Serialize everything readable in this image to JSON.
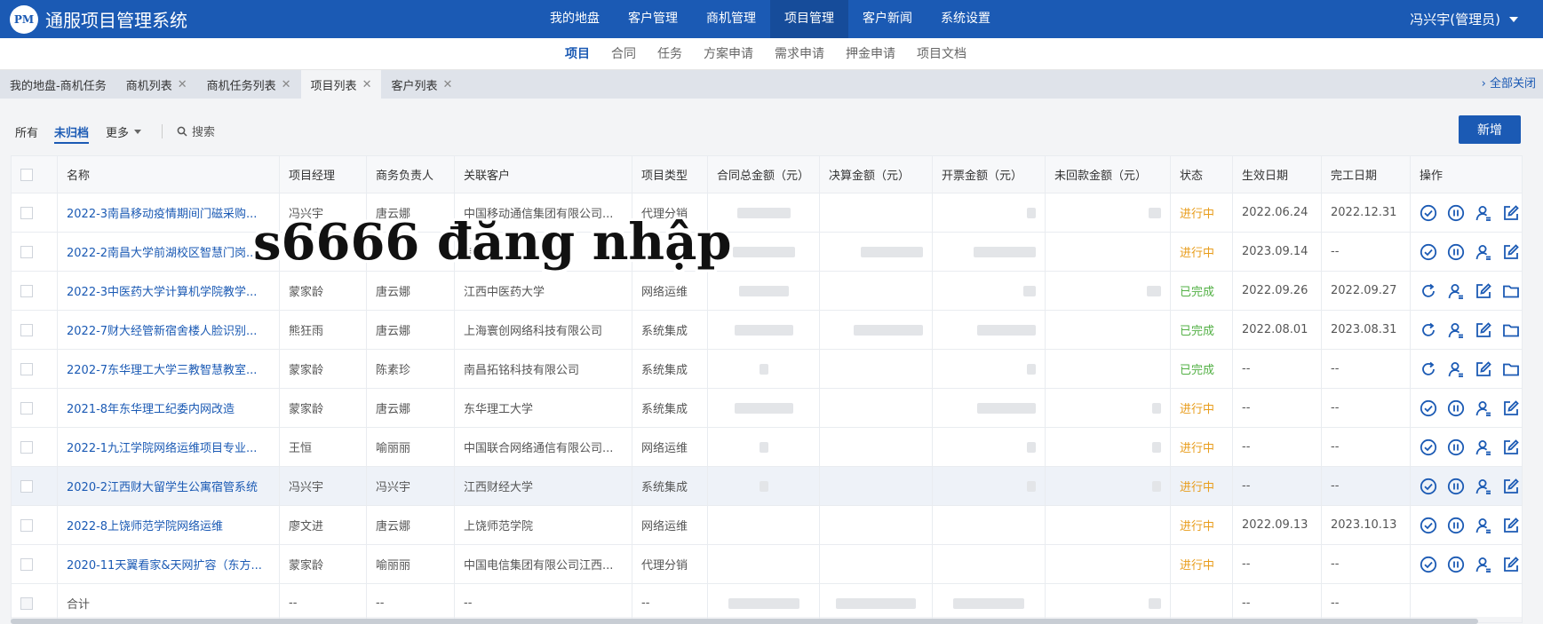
{
  "app": {
    "logo": "PM",
    "title": "通服项目管理系统"
  },
  "topnav": {
    "items": [
      {
        "label": "我的地盘"
      },
      {
        "label": "客户管理"
      },
      {
        "label": "商机管理"
      },
      {
        "label": "项目管理"
      },
      {
        "label": "客户新闻"
      },
      {
        "label": "系统设置"
      }
    ],
    "active_index": 3
  },
  "user": {
    "label": "冯兴宇(管理员)"
  },
  "subnav": {
    "items": [
      {
        "label": "项目"
      },
      {
        "label": "合同"
      },
      {
        "label": "任务"
      },
      {
        "label": "方案申请"
      },
      {
        "label": "需求申请"
      },
      {
        "label": "押金申请"
      },
      {
        "label": "项目文档"
      }
    ],
    "active_index": 0
  },
  "tabs": {
    "items": [
      {
        "label": "我的地盘-商机任务",
        "closable": false
      },
      {
        "label": "商机列表",
        "closable": true
      },
      {
        "label": "商机任务列表",
        "closable": true
      },
      {
        "label": "项目列表",
        "closable": true
      },
      {
        "label": "客户列表",
        "closable": true
      }
    ],
    "active_index": 3,
    "close_all": "› 全部关闭"
  },
  "toolbar": {
    "filters": [
      {
        "label": "所有"
      },
      {
        "label": "未归档"
      },
      {
        "label": "更多"
      }
    ],
    "active_filter": 1,
    "search_label": "搜索",
    "add_label": "新增"
  },
  "table": {
    "headers": [
      "名称",
      "项目经理",
      "商务负责人",
      "关联客户",
      "项目类型",
      "合同总金额（元）",
      "决算金额（元）",
      "开票金额（元）",
      "未回款金额（元）",
      "状态",
      "生效日期",
      "完工日期",
      "操作"
    ],
    "rows": [
      {
        "name": "2022-3南昌移动疫情期间门磁采购...",
        "manager": "冯兴宇",
        "business": "唐云娜",
        "customer": "中国移动通信集团有限公司...",
        "type": "代理分销",
        "status": "进行中",
        "start": "2022.06.24",
        "end": "2022.12.31",
        "ops": [
          "check-circle-icon",
          "pause-circle-icon",
          "user-assign-icon",
          "edit-icon"
        ]
      },
      {
        "name": "2022-2南昌大学前湖校区智慧门岗...",
        "manager": "",
        "business": "",
        "customer": "有限",
        "type": "",
        "status": "进行中",
        "start": "2023.09.14",
        "end": "--",
        "ops": [
          "check-circle-icon",
          "pause-circle-icon",
          "user-assign-icon",
          "edit-icon"
        ]
      },
      {
        "name": "2022-3中医药大学计算机学院教学...",
        "manager": "蒙家龄",
        "business": "唐云娜",
        "customer": "江西中医药大学",
        "type": "网络运维",
        "status": "已完成",
        "start": "2022.09.26",
        "end": "2022.09.27",
        "ops": [
          "refresh-icon",
          "user-assign-icon",
          "edit-icon",
          "folder-icon"
        ]
      },
      {
        "name": "2022-7财大经管新宿舍楼人脸识别...",
        "manager": "熊狂雨",
        "business": "唐云娜",
        "customer": "上海寰创网络科技有限公司",
        "type": "系统集成",
        "status": "已完成",
        "start": "2022.08.01",
        "end": "2023.08.31",
        "ops": [
          "refresh-icon",
          "user-assign-icon",
          "edit-icon",
          "folder-icon"
        ]
      },
      {
        "name": "2202-7东华理工大学三教智慧教室...",
        "manager": "蒙家龄",
        "business": "陈素珍",
        "customer": "南昌拓铭科技有限公司",
        "type": "系统集成",
        "status": "已完成",
        "start": "--",
        "end": "--",
        "ops": [
          "refresh-icon",
          "user-assign-icon",
          "edit-icon",
          "folder-icon"
        ]
      },
      {
        "name": "2021-8年东华理工纪委内网改造",
        "manager": "蒙家龄",
        "business": "唐云娜",
        "customer": "东华理工大学",
        "type": "系统集成",
        "status": "进行中",
        "start": "--",
        "end": "--",
        "ops": [
          "check-circle-icon",
          "pause-circle-icon",
          "user-assign-icon",
          "edit-icon"
        ]
      },
      {
        "name": "2022-1九江学院网络运维项目专业...",
        "manager": "王恒",
        "business": "喻丽丽",
        "customer": "中国联合网络通信有限公司...",
        "type": "网络运维",
        "status": "进行中",
        "start": "--",
        "end": "--",
        "ops": [
          "check-circle-icon",
          "pause-circle-icon",
          "user-assign-icon",
          "edit-icon"
        ]
      },
      {
        "name": "2020-2江西财大留学生公寓宿管系统",
        "manager": "冯兴宇",
        "business": "冯兴宇",
        "customer": "江西财经大学",
        "type": "系统集成",
        "status": "进行中",
        "start": "--",
        "end": "--",
        "ops": [
          "check-circle-icon",
          "pause-circle-icon",
          "user-assign-icon",
          "edit-icon"
        ]
      },
      {
        "name": "2022-8上饶师范学院网络运维",
        "manager": "廖文进",
        "business": "唐云娜",
        "customer": "上饶师范学院",
        "type": "网络运维",
        "status": "进行中",
        "start": "2022.09.13",
        "end": "2023.10.13",
        "ops": [
          "check-circle-icon",
          "pause-circle-icon",
          "user-assign-icon",
          "edit-icon"
        ]
      },
      {
        "name": "2020-11天翼看家&天网扩容（东方...",
        "manager": "蒙家龄",
        "business": "喻丽丽",
        "customer": "中国电信集团有限公司江西...",
        "type": "代理分销",
        "status": "进行中",
        "start": "--",
        "end": "--",
        "ops": [
          "check-circle-icon",
          "pause-circle-icon",
          "user-assign-icon",
          "edit-icon"
        ]
      }
    ],
    "total": {
      "label": "合计",
      "manager": "--",
      "business": "--",
      "customer": "--",
      "type": "--",
      "start": "--",
      "end": "--"
    }
  },
  "watermark": "s6666 đăng nhập",
  "colors": {
    "primary": "#1b5ab4",
    "running": "#e89c1a",
    "done": "#52b044"
  }
}
